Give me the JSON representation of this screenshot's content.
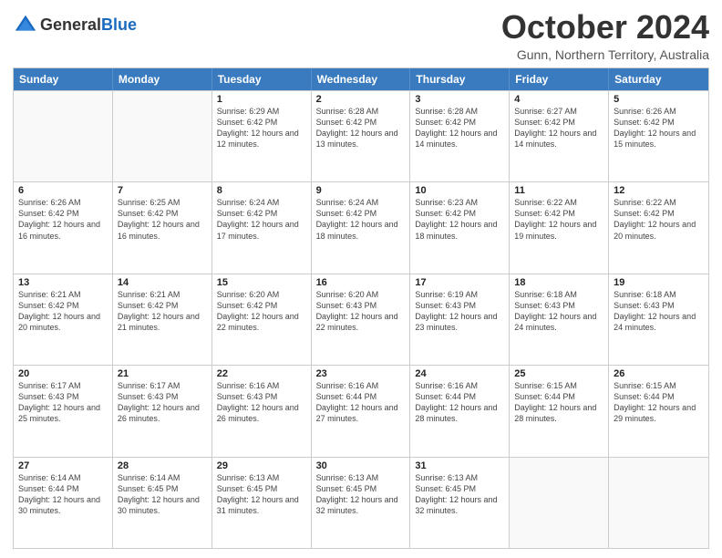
{
  "logo": {
    "general": "General",
    "blue": "Blue"
  },
  "header": {
    "title": "October 2024",
    "subtitle": "Gunn, Northern Territory, Australia"
  },
  "days": [
    "Sunday",
    "Monday",
    "Tuesday",
    "Wednesday",
    "Thursday",
    "Friday",
    "Saturday"
  ],
  "weeks": [
    [
      {
        "day": "",
        "sunrise": "",
        "sunset": "",
        "daylight": "",
        "empty": true
      },
      {
        "day": "",
        "sunrise": "",
        "sunset": "",
        "daylight": "",
        "empty": true
      },
      {
        "day": "1",
        "sunrise": "Sunrise: 6:29 AM",
        "sunset": "Sunset: 6:42 PM",
        "daylight": "Daylight: 12 hours and 12 minutes."
      },
      {
        "day": "2",
        "sunrise": "Sunrise: 6:28 AM",
        "sunset": "Sunset: 6:42 PM",
        "daylight": "Daylight: 12 hours and 13 minutes."
      },
      {
        "day": "3",
        "sunrise": "Sunrise: 6:28 AM",
        "sunset": "Sunset: 6:42 PM",
        "daylight": "Daylight: 12 hours and 14 minutes."
      },
      {
        "day": "4",
        "sunrise": "Sunrise: 6:27 AM",
        "sunset": "Sunset: 6:42 PM",
        "daylight": "Daylight: 12 hours and 14 minutes."
      },
      {
        "day": "5",
        "sunrise": "Sunrise: 6:26 AM",
        "sunset": "Sunset: 6:42 PM",
        "daylight": "Daylight: 12 hours and 15 minutes."
      }
    ],
    [
      {
        "day": "6",
        "sunrise": "Sunrise: 6:26 AM",
        "sunset": "Sunset: 6:42 PM",
        "daylight": "Daylight: 12 hours and 16 minutes."
      },
      {
        "day": "7",
        "sunrise": "Sunrise: 6:25 AM",
        "sunset": "Sunset: 6:42 PM",
        "daylight": "Daylight: 12 hours and 16 minutes."
      },
      {
        "day": "8",
        "sunrise": "Sunrise: 6:24 AM",
        "sunset": "Sunset: 6:42 PM",
        "daylight": "Daylight: 12 hours and 17 minutes."
      },
      {
        "day": "9",
        "sunrise": "Sunrise: 6:24 AM",
        "sunset": "Sunset: 6:42 PM",
        "daylight": "Daylight: 12 hours and 18 minutes."
      },
      {
        "day": "10",
        "sunrise": "Sunrise: 6:23 AM",
        "sunset": "Sunset: 6:42 PM",
        "daylight": "Daylight: 12 hours and 18 minutes."
      },
      {
        "day": "11",
        "sunrise": "Sunrise: 6:22 AM",
        "sunset": "Sunset: 6:42 PM",
        "daylight": "Daylight: 12 hours and 19 minutes."
      },
      {
        "day": "12",
        "sunrise": "Sunrise: 6:22 AM",
        "sunset": "Sunset: 6:42 PM",
        "daylight": "Daylight: 12 hours and 20 minutes."
      }
    ],
    [
      {
        "day": "13",
        "sunrise": "Sunrise: 6:21 AM",
        "sunset": "Sunset: 6:42 PM",
        "daylight": "Daylight: 12 hours and 20 minutes."
      },
      {
        "day": "14",
        "sunrise": "Sunrise: 6:21 AM",
        "sunset": "Sunset: 6:42 PM",
        "daylight": "Daylight: 12 hours and 21 minutes."
      },
      {
        "day": "15",
        "sunrise": "Sunrise: 6:20 AM",
        "sunset": "Sunset: 6:42 PM",
        "daylight": "Daylight: 12 hours and 22 minutes."
      },
      {
        "day": "16",
        "sunrise": "Sunrise: 6:20 AM",
        "sunset": "Sunset: 6:43 PM",
        "daylight": "Daylight: 12 hours and 22 minutes."
      },
      {
        "day": "17",
        "sunrise": "Sunrise: 6:19 AM",
        "sunset": "Sunset: 6:43 PM",
        "daylight": "Daylight: 12 hours and 23 minutes."
      },
      {
        "day": "18",
        "sunrise": "Sunrise: 6:18 AM",
        "sunset": "Sunset: 6:43 PM",
        "daylight": "Daylight: 12 hours and 24 minutes."
      },
      {
        "day": "19",
        "sunrise": "Sunrise: 6:18 AM",
        "sunset": "Sunset: 6:43 PM",
        "daylight": "Daylight: 12 hours and 24 minutes."
      }
    ],
    [
      {
        "day": "20",
        "sunrise": "Sunrise: 6:17 AM",
        "sunset": "Sunset: 6:43 PM",
        "daylight": "Daylight: 12 hours and 25 minutes."
      },
      {
        "day": "21",
        "sunrise": "Sunrise: 6:17 AM",
        "sunset": "Sunset: 6:43 PM",
        "daylight": "Daylight: 12 hours and 26 minutes."
      },
      {
        "day": "22",
        "sunrise": "Sunrise: 6:16 AM",
        "sunset": "Sunset: 6:43 PM",
        "daylight": "Daylight: 12 hours and 26 minutes."
      },
      {
        "day": "23",
        "sunrise": "Sunrise: 6:16 AM",
        "sunset": "Sunset: 6:44 PM",
        "daylight": "Daylight: 12 hours and 27 minutes."
      },
      {
        "day": "24",
        "sunrise": "Sunrise: 6:16 AM",
        "sunset": "Sunset: 6:44 PM",
        "daylight": "Daylight: 12 hours and 28 minutes."
      },
      {
        "day": "25",
        "sunrise": "Sunrise: 6:15 AM",
        "sunset": "Sunset: 6:44 PM",
        "daylight": "Daylight: 12 hours and 28 minutes."
      },
      {
        "day": "26",
        "sunrise": "Sunrise: 6:15 AM",
        "sunset": "Sunset: 6:44 PM",
        "daylight": "Daylight: 12 hours and 29 minutes."
      }
    ],
    [
      {
        "day": "27",
        "sunrise": "Sunrise: 6:14 AM",
        "sunset": "Sunset: 6:44 PM",
        "daylight": "Daylight: 12 hours and 30 minutes."
      },
      {
        "day": "28",
        "sunrise": "Sunrise: 6:14 AM",
        "sunset": "Sunset: 6:45 PM",
        "daylight": "Daylight: 12 hours and 30 minutes."
      },
      {
        "day": "29",
        "sunrise": "Sunrise: 6:13 AM",
        "sunset": "Sunset: 6:45 PM",
        "daylight": "Daylight: 12 hours and 31 minutes."
      },
      {
        "day": "30",
        "sunrise": "Sunrise: 6:13 AM",
        "sunset": "Sunset: 6:45 PM",
        "daylight": "Daylight: 12 hours and 32 minutes."
      },
      {
        "day": "31",
        "sunrise": "Sunrise: 6:13 AM",
        "sunset": "Sunset: 6:45 PM",
        "daylight": "Daylight: 12 hours and 32 minutes."
      },
      {
        "day": "",
        "sunrise": "",
        "sunset": "",
        "daylight": "",
        "empty": true
      },
      {
        "day": "",
        "sunrise": "",
        "sunset": "",
        "daylight": "",
        "empty": true
      }
    ]
  ]
}
